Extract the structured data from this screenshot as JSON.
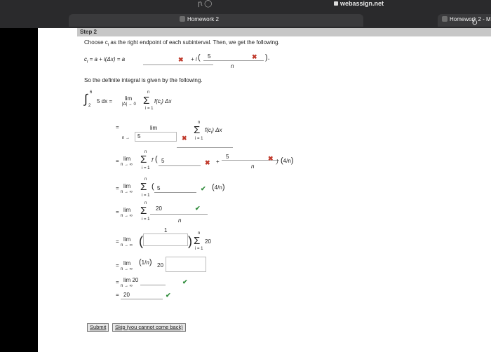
{
  "browser": {
    "url": "webassign.net",
    "tab_active": "Homework 2",
    "tab_other": "Homework 2 - M",
    "toolbar_glyphs": "ꞃ ◯"
  },
  "step": {
    "title": "Step 2"
  },
  "text": {
    "choose": "Choose c",
    "choose_sub": "i",
    "choose_rest": " as the right endpoint of each subinterval. Then, we get the following.",
    "ci_line": "c",
    "ci_sub": "i",
    "ci_eq": " = a + i(Δx) = a",
    "plus_i": "+ i",
    "frac_5": "5",
    "frac_n": "n",
    "definite": "So the definite integral is given by the following.",
    "integral_upper": "6",
    "integral_lower": "2",
    "integrand": "5 dx =",
    "lim": "lim",
    "lim_sub_delta": "|Δ| → 0",
    "sum_upper": "n",
    "sum_lower": "i = 1",
    "f_ci_dx": "f(c",
    "f_ci_dx_sub": "i",
    "f_ci_dx_end": ") Δx",
    "equals": "=",
    "n_to": "n →",
    "n_to_inf": "n → ∞",
    "row1_box": "5",
    "row2_box": "5",
    "row3_box": "5",
    "row4_num": "20",
    "row4_den": "n",
    "row5_one": "1",
    "row5_20": "20",
    "row6_half": "1",
    "row6_20": "20 ·",
    "row7": "lim   20",
    "final": "20",
    "four": "4",
    "f_open": "f",
    "plus": "+",
    "cdot_f": "· f"
  },
  "marks": {
    "wrong": "✖",
    "correct": "✔"
  },
  "buttons": {
    "submit": "Submit",
    "skip": "Skip (you cannot come back)"
  }
}
